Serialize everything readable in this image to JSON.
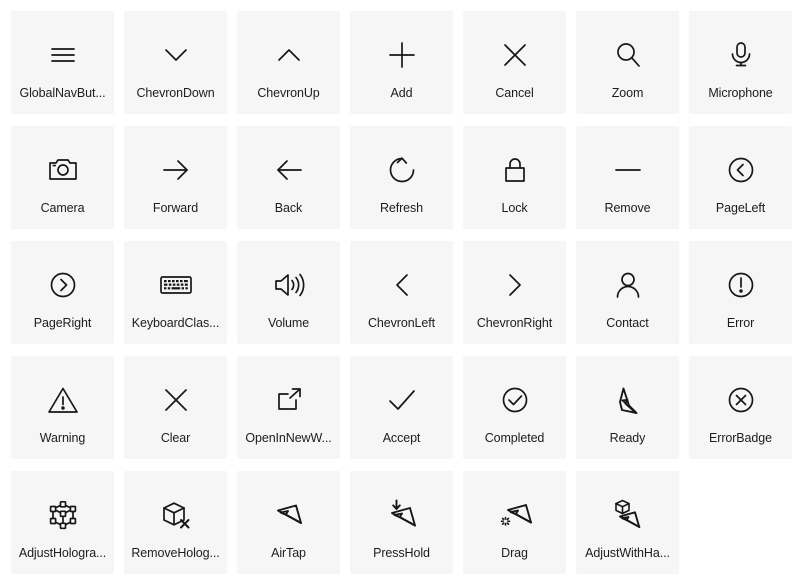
{
  "gallery": {
    "columns": 7,
    "rows": 5,
    "tile_background": "#f6f6f6",
    "page_background": "#ffffff",
    "icon_color": "#17171a",
    "label_color": "#1d1d1f",
    "items": [
      {
        "icon": "global-nav-button-icon",
        "label": "GlobalNavBut...",
        "full_name": "GlobalNavButton"
      },
      {
        "icon": "chevron-down-icon",
        "label": "ChevronDown",
        "full_name": "ChevronDown"
      },
      {
        "icon": "chevron-up-icon",
        "label": "ChevronUp",
        "full_name": "ChevronUp"
      },
      {
        "icon": "add-icon",
        "label": "Add",
        "full_name": "Add"
      },
      {
        "icon": "cancel-icon",
        "label": "Cancel",
        "full_name": "Cancel"
      },
      {
        "icon": "zoom-icon",
        "label": "Zoom",
        "full_name": "Zoom"
      },
      {
        "icon": "microphone-icon",
        "label": "Microphone",
        "full_name": "Microphone"
      },
      {
        "icon": "camera-icon",
        "label": "Camera",
        "full_name": "Camera"
      },
      {
        "icon": "forward-icon",
        "label": "Forward",
        "full_name": "Forward"
      },
      {
        "icon": "back-icon",
        "label": "Back",
        "full_name": "Back"
      },
      {
        "icon": "refresh-icon",
        "label": "Refresh",
        "full_name": "Refresh"
      },
      {
        "icon": "lock-icon",
        "label": "Lock",
        "full_name": "Lock"
      },
      {
        "icon": "remove-icon",
        "label": "Remove",
        "full_name": "Remove"
      },
      {
        "icon": "page-left-icon",
        "label": "PageLeft",
        "full_name": "PageLeft"
      },
      {
        "icon": "page-right-icon",
        "label": "PageRight",
        "full_name": "PageRight"
      },
      {
        "icon": "keyboard-classic-icon",
        "label": "KeyboardClas...",
        "full_name": "KeyboardClassic"
      },
      {
        "icon": "volume-icon",
        "label": "Volume",
        "full_name": "Volume"
      },
      {
        "icon": "chevron-left-icon",
        "label": "ChevronLeft",
        "full_name": "ChevronLeft"
      },
      {
        "icon": "chevron-right-icon",
        "label": "ChevronRight",
        "full_name": "ChevronRight"
      },
      {
        "icon": "contact-icon",
        "label": "Contact",
        "full_name": "Contact"
      },
      {
        "icon": "error-icon",
        "label": "Error",
        "full_name": "Error"
      },
      {
        "icon": "warning-icon",
        "label": "Warning",
        "full_name": "Warning"
      },
      {
        "icon": "clear-icon",
        "label": "Clear",
        "full_name": "Clear"
      },
      {
        "icon": "open-in-new-window-icon",
        "label": "OpenInNewW...",
        "full_name": "OpenInNewWindow"
      },
      {
        "icon": "accept-icon",
        "label": "Accept",
        "full_name": "Accept"
      },
      {
        "icon": "completed-icon",
        "label": "Completed",
        "full_name": "Completed"
      },
      {
        "icon": "ready-icon",
        "label": "Ready",
        "full_name": "Ready"
      },
      {
        "icon": "error-badge-icon",
        "label": "ErrorBadge",
        "full_name": "ErrorBadge"
      },
      {
        "icon": "adjust-hologram-icon",
        "label": "AdjustHologra...",
        "full_name": "AdjustHologram"
      },
      {
        "icon": "remove-hologram-icon",
        "label": "RemoveHolog...",
        "full_name": "RemoveHologram"
      },
      {
        "icon": "air-tap-icon",
        "label": "AirTap",
        "full_name": "AirTap"
      },
      {
        "icon": "press-hold-icon",
        "label": "PressHold",
        "full_name": "PressHold"
      },
      {
        "icon": "drag-icon",
        "label": "Drag",
        "full_name": "Drag"
      },
      {
        "icon": "adjust-with-hand-icon",
        "label": "AdjustWithHa...",
        "full_name": "AdjustWithHand"
      }
    ]
  }
}
